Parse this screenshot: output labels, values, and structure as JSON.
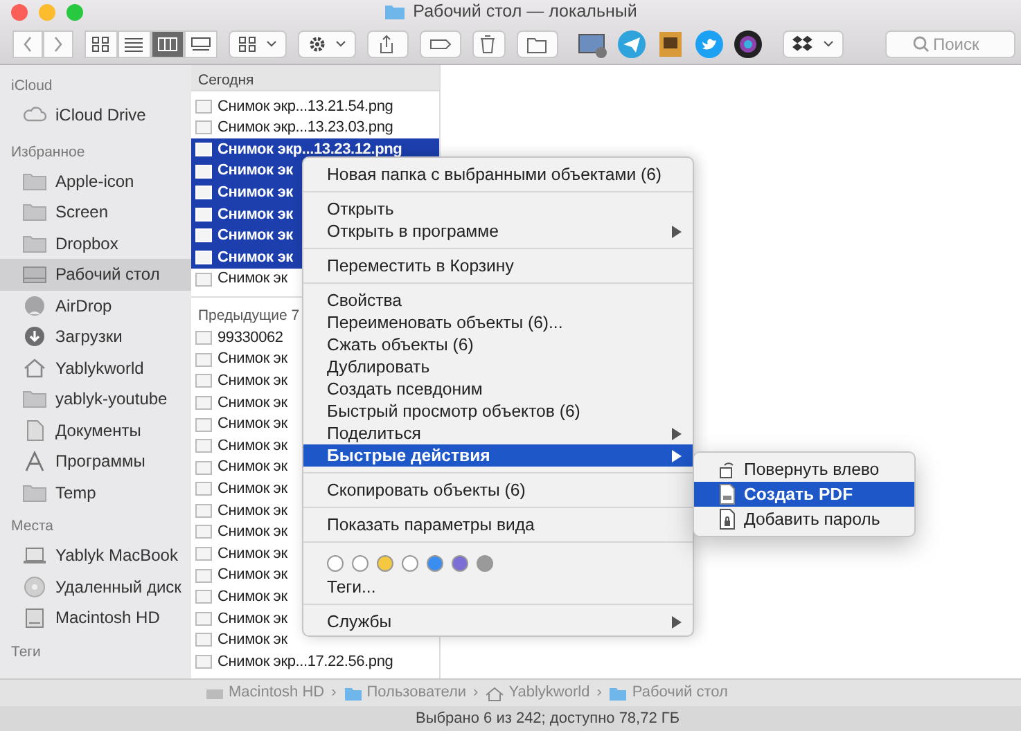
{
  "window": {
    "title": "Рабочий стол — локальный"
  },
  "toolbar": {
    "view_modes": [
      {
        "kind": "icons",
        "selected": false
      },
      {
        "kind": "list",
        "selected": false
      },
      {
        "kind": "columns",
        "selected": true
      },
      {
        "kind": "gallery",
        "selected": false
      }
    ],
    "search": {
      "placeholder": "Поиск"
    }
  },
  "sidebar": {
    "sections": [
      {
        "heading": "iCloud",
        "items": [
          {
            "label": "iCloud Drive",
            "kind": "cloud",
            "selected": false
          }
        ]
      },
      {
        "heading": "Избранное",
        "items": [
          {
            "label": "Apple-icon",
            "kind": "folder",
            "selected": false
          },
          {
            "label": "Screen",
            "kind": "folder",
            "selected": false
          },
          {
            "label": "Dropbox",
            "kind": "folder",
            "selected": false
          },
          {
            "label": "Рабочий стол",
            "kind": "desktop",
            "selected": true
          },
          {
            "label": "AirDrop",
            "kind": "airdrop",
            "selected": false
          },
          {
            "label": "Загрузки",
            "kind": "download",
            "selected": false
          },
          {
            "label": "Yablykworld",
            "kind": "home",
            "selected": false
          },
          {
            "label": "yablyk-youtube",
            "kind": "folder",
            "selected": false
          },
          {
            "label": "Документы",
            "kind": "document",
            "selected": false
          },
          {
            "label": "Программы",
            "kind": "apps",
            "selected": false
          },
          {
            "label": "Temp",
            "kind": "folder",
            "selected": false
          }
        ]
      },
      {
        "heading": "Места",
        "items": [
          {
            "label": "Yablyk MacBook",
            "kind": "laptop",
            "selected": false
          },
          {
            "label": "Удаленный диск",
            "kind": "disc",
            "selected": false
          },
          {
            "label": "Macintosh HD",
            "kind": "drive",
            "selected": false
          }
        ]
      },
      {
        "heading": "Теги"
      }
    ]
  },
  "file_column": {
    "sections": [
      {
        "heading": "Сегодня",
        "files": [
          {
            "name": "Снимок экр...13.21.54.png",
            "selected": false
          },
          {
            "name": "Снимок экр...13.23.03.png",
            "selected": false
          },
          {
            "name": "Снимок экр...13.23.12.png",
            "selected": true
          },
          {
            "name": "Снимок эк",
            "selected": true
          },
          {
            "name": "Снимок эк",
            "selected": true
          },
          {
            "name": "Снимок эк",
            "selected": true
          },
          {
            "name": "Снимок эк",
            "selected": true
          },
          {
            "name": "Снимок эк",
            "selected": true
          },
          {
            "name": "Снимок эк",
            "selected": false
          }
        ]
      },
      {
        "heading": "Предыдущие 7",
        "files": [
          {
            "name": "99330062",
            "selected": false
          },
          {
            "name": "Снимок эк",
            "selected": false
          },
          {
            "name": "Снимок эк",
            "selected": false
          },
          {
            "name": "Снимок эк",
            "selected": false
          },
          {
            "name": "Снимок эк",
            "selected": false
          },
          {
            "name": "Снимок эк",
            "selected": false
          },
          {
            "name": "Снимок эк",
            "selected": false
          },
          {
            "name": "Снимок эк",
            "selected": false
          },
          {
            "name": "Снимок эк",
            "selected": false
          },
          {
            "name": "Снимок эк",
            "selected": false
          },
          {
            "name": "Снимок эк",
            "selected": false
          },
          {
            "name": "Снимок эк",
            "selected": false
          },
          {
            "name": "Снимок эк",
            "selected": false
          },
          {
            "name": "Снимок эк",
            "selected": false
          },
          {
            "name": "Снимок эк",
            "selected": false
          },
          {
            "name": "Снимок экр...17.22.56.png",
            "selected": false
          }
        ]
      }
    ]
  },
  "context_menu": {
    "items": [
      {
        "kind": "item",
        "label": "Новая папка с выбранными объектами (6)",
        "submenu": false,
        "selected": false
      },
      {
        "kind": "separator"
      },
      {
        "kind": "item",
        "label": "Открыть",
        "submenu": false,
        "selected": false
      },
      {
        "kind": "item",
        "label": "Открыть в программе",
        "submenu": true,
        "selected": false
      },
      {
        "kind": "separator"
      },
      {
        "kind": "item",
        "label": "Переместить в Корзину",
        "submenu": false,
        "selected": false
      },
      {
        "kind": "separator"
      },
      {
        "kind": "item",
        "label": "Свойства",
        "submenu": false,
        "selected": false
      },
      {
        "kind": "item",
        "label": "Переименовать объекты (6)...",
        "submenu": false,
        "selected": false
      },
      {
        "kind": "item",
        "label": "Сжать объекты (6)",
        "submenu": false,
        "selected": false
      },
      {
        "kind": "item",
        "label": "Дублировать",
        "submenu": false,
        "selected": false
      },
      {
        "kind": "item",
        "label": "Создать псевдоним",
        "submenu": false,
        "selected": false
      },
      {
        "kind": "item",
        "label": "Быстрый просмотр объектов (6)",
        "submenu": false,
        "selected": false
      },
      {
        "kind": "item",
        "label": "Поделиться",
        "submenu": true,
        "selected": false
      },
      {
        "kind": "item",
        "label": "Быстрые действия",
        "submenu": true,
        "selected": true
      },
      {
        "kind": "separator"
      },
      {
        "kind": "item",
        "label": "Скопировать объекты (6)",
        "submenu": false,
        "selected": false
      },
      {
        "kind": "separator"
      },
      {
        "kind": "item",
        "label": "Показать параметры вида",
        "submenu": false,
        "selected": false
      },
      {
        "kind": "separator"
      },
      {
        "kind": "tags",
        "colors": [
          {
            "color": "#ffffff"
          },
          {
            "color": "#ffffff"
          },
          {
            "color": "#f5c842"
          },
          {
            "color": "#ffffff"
          },
          {
            "color": "#3a8ef0"
          },
          {
            "color": "#7b6fd6"
          },
          {
            "color": "#9a9a9a"
          }
        ]
      },
      {
        "kind": "item",
        "label": "Теги...",
        "submenu": false,
        "selected": false
      },
      {
        "kind": "separator"
      },
      {
        "kind": "item",
        "label": "Службы",
        "submenu": true,
        "selected": false
      }
    ]
  },
  "submenu": {
    "items": [
      {
        "label": "Повернуть влево",
        "kind": "rotate",
        "selected": false
      },
      {
        "label": "Создать PDF",
        "kind": "pdf",
        "selected": true
      },
      {
        "label": "Добавить пароль",
        "kind": "lock",
        "selected": false
      }
    ]
  },
  "path_separator": "›",
  "path_bar": [
    {
      "label": "Macintosh HD",
      "kind": "drive"
    },
    {
      "label": "Пользователи",
      "kind": "folder"
    },
    {
      "label": "Yablykworld",
      "kind": "home"
    },
    {
      "label": "Рабочий стол",
      "kind": "folder"
    }
  ],
  "status_bar": "Выбрано 6 из 242; доступно 78,72 ГБ"
}
